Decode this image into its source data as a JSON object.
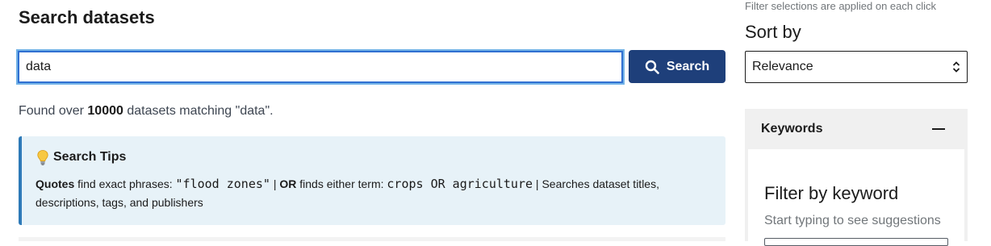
{
  "main": {
    "title": "Search datasets",
    "search": {
      "value": "data",
      "button_label": "Search"
    },
    "results": {
      "prefix": "Found over ",
      "count": "10000",
      "suffix": " datasets matching \"data\"."
    },
    "tips": {
      "heading": "Search Tips",
      "quotes_label": "Quotes",
      "quotes_text": " find exact phrases: ",
      "quotes_example": "\"flood zones\"",
      "sep1": " | ",
      "or_label": "OR",
      "or_text": " finds either term: ",
      "or_example": "crops OR agriculture",
      "sep2": " | ",
      "scope_text": "Searches dataset titles, descriptions, tags, and publishers"
    }
  },
  "sidebar": {
    "note": "Filter selections are applied on each click",
    "sort_label": "Sort by",
    "sort_value": "Relevance",
    "keywords": {
      "header": "Keywords",
      "filter_title": "Filter by keyword",
      "hint": "Start typing to see suggestions"
    }
  },
  "colors": {
    "primary_button": "#1e3f7a",
    "focus_ring": "#2f6fd1",
    "tips_background": "#e7f2f8",
    "tips_border": "#2e7ab8",
    "panel_background": "#f0f0f0"
  },
  "icons": [
    "search-icon",
    "lightbulb-icon",
    "sort-chevrons-icon",
    "minus-icon"
  ]
}
